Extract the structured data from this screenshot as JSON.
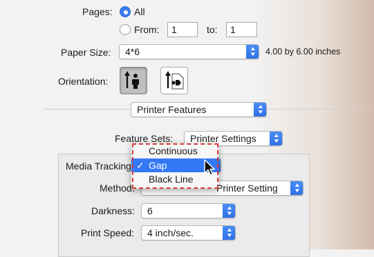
{
  "pages": {
    "label": "Pages:",
    "all_label": "All",
    "from_label": "From:",
    "from_value": "1",
    "to_label": "to:",
    "to_value": "1"
  },
  "paper_size": {
    "label": "Paper Size:",
    "value": "4*6",
    "dimensions": "4.00 by 6.00 inches"
  },
  "orientation": {
    "label": "Orientation:",
    "options": [
      "portrait",
      "landscape"
    ],
    "selected": "portrait"
  },
  "section_popup": {
    "value": "Printer Features"
  },
  "feature_sets": {
    "label": "Feature Sets:",
    "value": "Printer Settings"
  },
  "media_tracking": {
    "label": "Media Tracking",
    "options": [
      "Continuous",
      "Gap",
      "Black Line"
    ],
    "selected": "Gap"
  },
  "method": {
    "label": "Method:",
    "value_visible": "Printer Setting"
  },
  "darkness": {
    "label": "Darkness:",
    "value": "6"
  },
  "print_speed": {
    "label": "Print Speed:",
    "value": "4 inch/sec."
  },
  "colors": {
    "accent": "#3478f6",
    "callout": "#d63b3b"
  }
}
